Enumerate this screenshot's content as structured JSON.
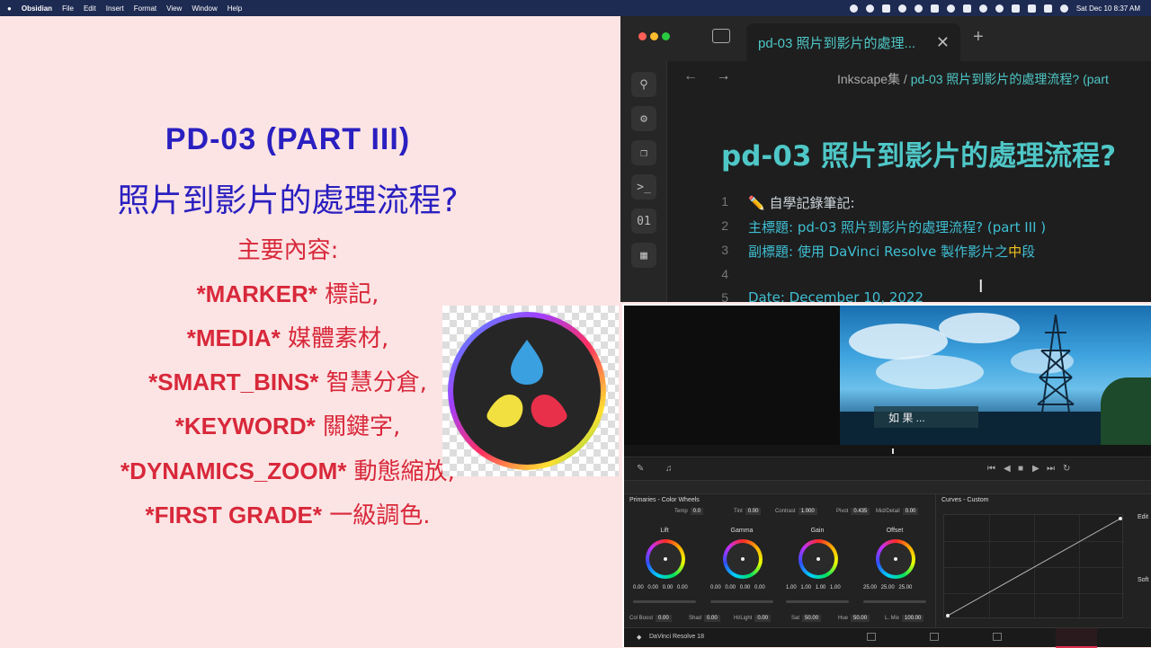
{
  "menubar": {
    "apple": "",
    "items": [
      "Obsidian",
      "File",
      "Edit",
      "Insert",
      "Format",
      "View",
      "Window",
      "Help"
    ],
    "clock": "Sat Dec 10  8:37 AM"
  },
  "slide": {
    "title_line1": "PD-03  (PART III)",
    "title_line2": "照片到影片的處理流程?",
    "subtitle": "主要內容:",
    "points": [
      {
        "en": "*MARKER*",
        "zh": " 標記,"
      },
      {
        "en": "*MEDIA*",
        "zh": " 媒體素材,"
      },
      {
        "en": "*SMART_BINS*",
        "zh": " 智慧分倉,"
      },
      {
        "en": "*KEYWORD*",
        "zh": " 關鍵字,"
      },
      {
        "en": "*DYNAMICS_ZOOM*",
        "zh": " 動態縮放,"
      },
      {
        "en": "*FIRST GRADE*",
        "zh": " 一級調色."
      }
    ]
  },
  "obsidian": {
    "tab_title": "pd-03 照片到影片的處理...",
    "tab_close": "✕",
    "new_tab": "+",
    "breadcrumb_folder": "Inkscape集",
    "breadcrumb_sep": " / ",
    "breadcrumb_file": "pd-03 照片到影片的處理流程? (part",
    "heading": "pd-03 照片到影片的處理流程?",
    "lines": [
      {
        "n": "1",
        "icon": "✏️",
        "text": " 自學記錄筆記:"
      },
      {
        "n": "2",
        "text": "主標題: pd-03 照片到影片的處理流程? (part III )"
      },
      {
        "n": "3",
        "text_a": "副標題: 使用 DaVinci Resolve 製作影片之",
        "text_b": "中",
        "text_c": "段"
      },
      {
        "n": "4",
        "text": ""
      },
      {
        "n": "5",
        "text": "Date:  December 10, 2022"
      }
    ]
  },
  "davinci": {
    "subtitle_overlay": "如 果 ...",
    "panel_title": "Primaries - Color Wheels",
    "curves_title": "Curves - Custom",
    "params_top": [
      {
        "label": "Temp",
        "value": "0.0"
      },
      {
        "label": "Tint",
        "value": "0.00"
      },
      {
        "label": "Contrast",
        "value": "1.000"
      },
      {
        "label": "Pivot",
        "value": "0.435"
      },
      {
        "label": "Mid/Detail",
        "value": "0.00"
      }
    ],
    "wheels": [
      {
        "name": "Lift",
        "values": "0.00  0.00  0.00  0.00"
      },
      {
        "name": "Gamma",
        "values": "0.00  0.00  0.00  0.00"
      },
      {
        "name": "Gain",
        "values": "1.00  1.00  1.00  1.00"
      },
      {
        "name": "Offset",
        "values": "25.00  25.00  25.00"
      }
    ],
    "params_bottom": [
      {
        "label": "Col Boost",
        "value": "0.00"
      },
      {
        "label": "Shad",
        "value": "0.00"
      },
      {
        "label": "Hi/Light",
        "value": "0.00"
      },
      {
        "label": "Sat",
        "value": "50.00"
      },
      {
        "label": "Hue",
        "value": "50.00"
      },
      {
        "label": "L. Mix",
        "value": "100.00"
      }
    ],
    "app_name": "DaVinci Resolve 18",
    "edit_label": "Edit",
    "soft_label": "Soft"
  }
}
